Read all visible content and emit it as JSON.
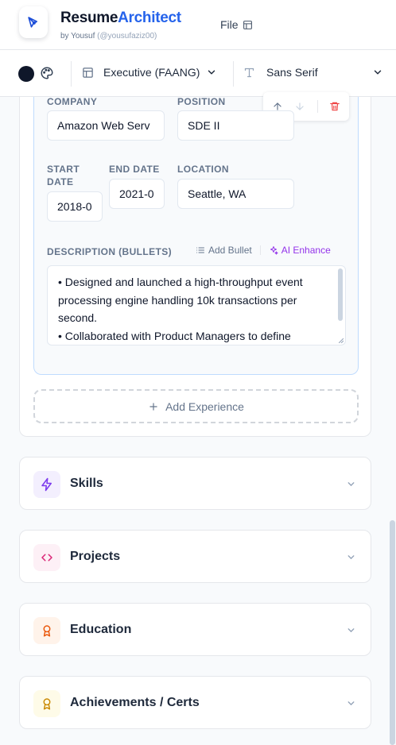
{
  "header": {
    "brand_part1": "Resume",
    "brand_part2": "Architect",
    "by": "by Yousuf",
    "handle": "(@yousufaziz00)",
    "file_menu": "File"
  },
  "toolbar": {
    "accent_color": "#0f172a",
    "template": "Executive (FAANG)",
    "font": "Sans Serif"
  },
  "experience": {
    "labels": {
      "company": "COMPANY",
      "position": "POSITION",
      "start_line1": "START",
      "start_line2": "DATE",
      "end": "END DATE",
      "location": "LOCATION",
      "description": "DESCRIPTION (BULLETS)"
    },
    "entry": {
      "company": "Amazon Web Serv",
      "position": "SDE II",
      "start": "2018-0",
      "end": "2021-0",
      "location": "Seattle, WA",
      "bullets": [
        "• Designed and launched a high-throughput event",
        "processing engine handling 10k transactions per",
        "second.",
        "• Collaborated with Product Managers to define"
      ]
    },
    "add_bullet": "Add Bullet",
    "ai_enhance": "AI Enhance",
    "add_experience": "Add Experience"
  },
  "sections": [
    {
      "title": "Skills",
      "icon": "lightning-icon",
      "color": "#7c3aed",
      "bg": "#f3effe"
    },
    {
      "title": "Projects",
      "icon": "code-icon",
      "color": "#db2777",
      "bg": "#fdf0f6"
    },
    {
      "title": "Education",
      "icon": "award-icon",
      "color": "#ea580c",
      "bg": "#fff3ea"
    },
    {
      "title": "Achievements / Certs",
      "icon": "award-icon",
      "color": "#ca8a04",
      "bg": "#fefbe8"
    }
  ]
}
